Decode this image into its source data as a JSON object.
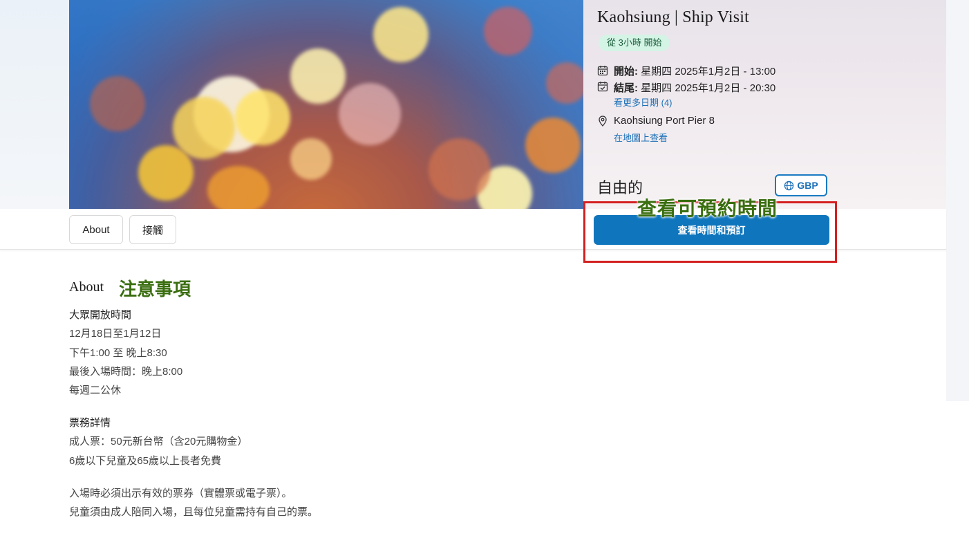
{
  "event": {
    "title": "Kaohsiung | Ship Visit",
    "badge": "從 3小時 開始",
    "start_label": "開始:",
    "start_value": "星期四 2025年1月2日 - 13:00",
    "end_label": "結尾:",
    "end_value": "星期四 2025年1月2日 - 20:30",
    "more_dates_link": "看更多日期 (4)",
    "location": "Kaohsiung Port Pier 8",
    "map_link": "在地圖上查看",
    "price": "自由的",
    "currency": "GBP",
    "book_button": "查看時間和預訂"
  },
  "annotations": {
    "booking_note": "查看可預約時間",
    "about_note": "注意事項"
  },
  "tabs": [
    {
      "label": "About"
    },
    {
      "label": "接觸"
    }
  ],
  "about": {
    "heading": "About",
    "opening_heading": "大眾開放時間",
    "opening_lines": [
      "12月18日至1月12日",
      "下午1:00 至 晚上8:30",
      "最後入場時間：晚上8:00",
      "每週二公休"
    ],
    "ticket_heading": "票務詳情",
    "ticket_lines": [
      "成人票：50元新台幣（含20元購物金）",
      "6歲以下兒童及65歲以上長者免費"
    ],
    "notes": [
      "入場時必須出示有效的票券（實體票或電子票）。",
      "兒童須由成人陪同入場，且每位兒童需持有自己的票。"
    ]
  },
  "colors": {
    "primary": "#0f75bc",
    "annotation_green": "#3a6e10",
    "annotation_red": "#d42020",
    "badge_bg": "#d4f4e6"
  },
  "icons": [
    "calendar-icon",
    "calendar-check-icon",
    "map-pin-icon",
    "globe-icon"
  ]
}
